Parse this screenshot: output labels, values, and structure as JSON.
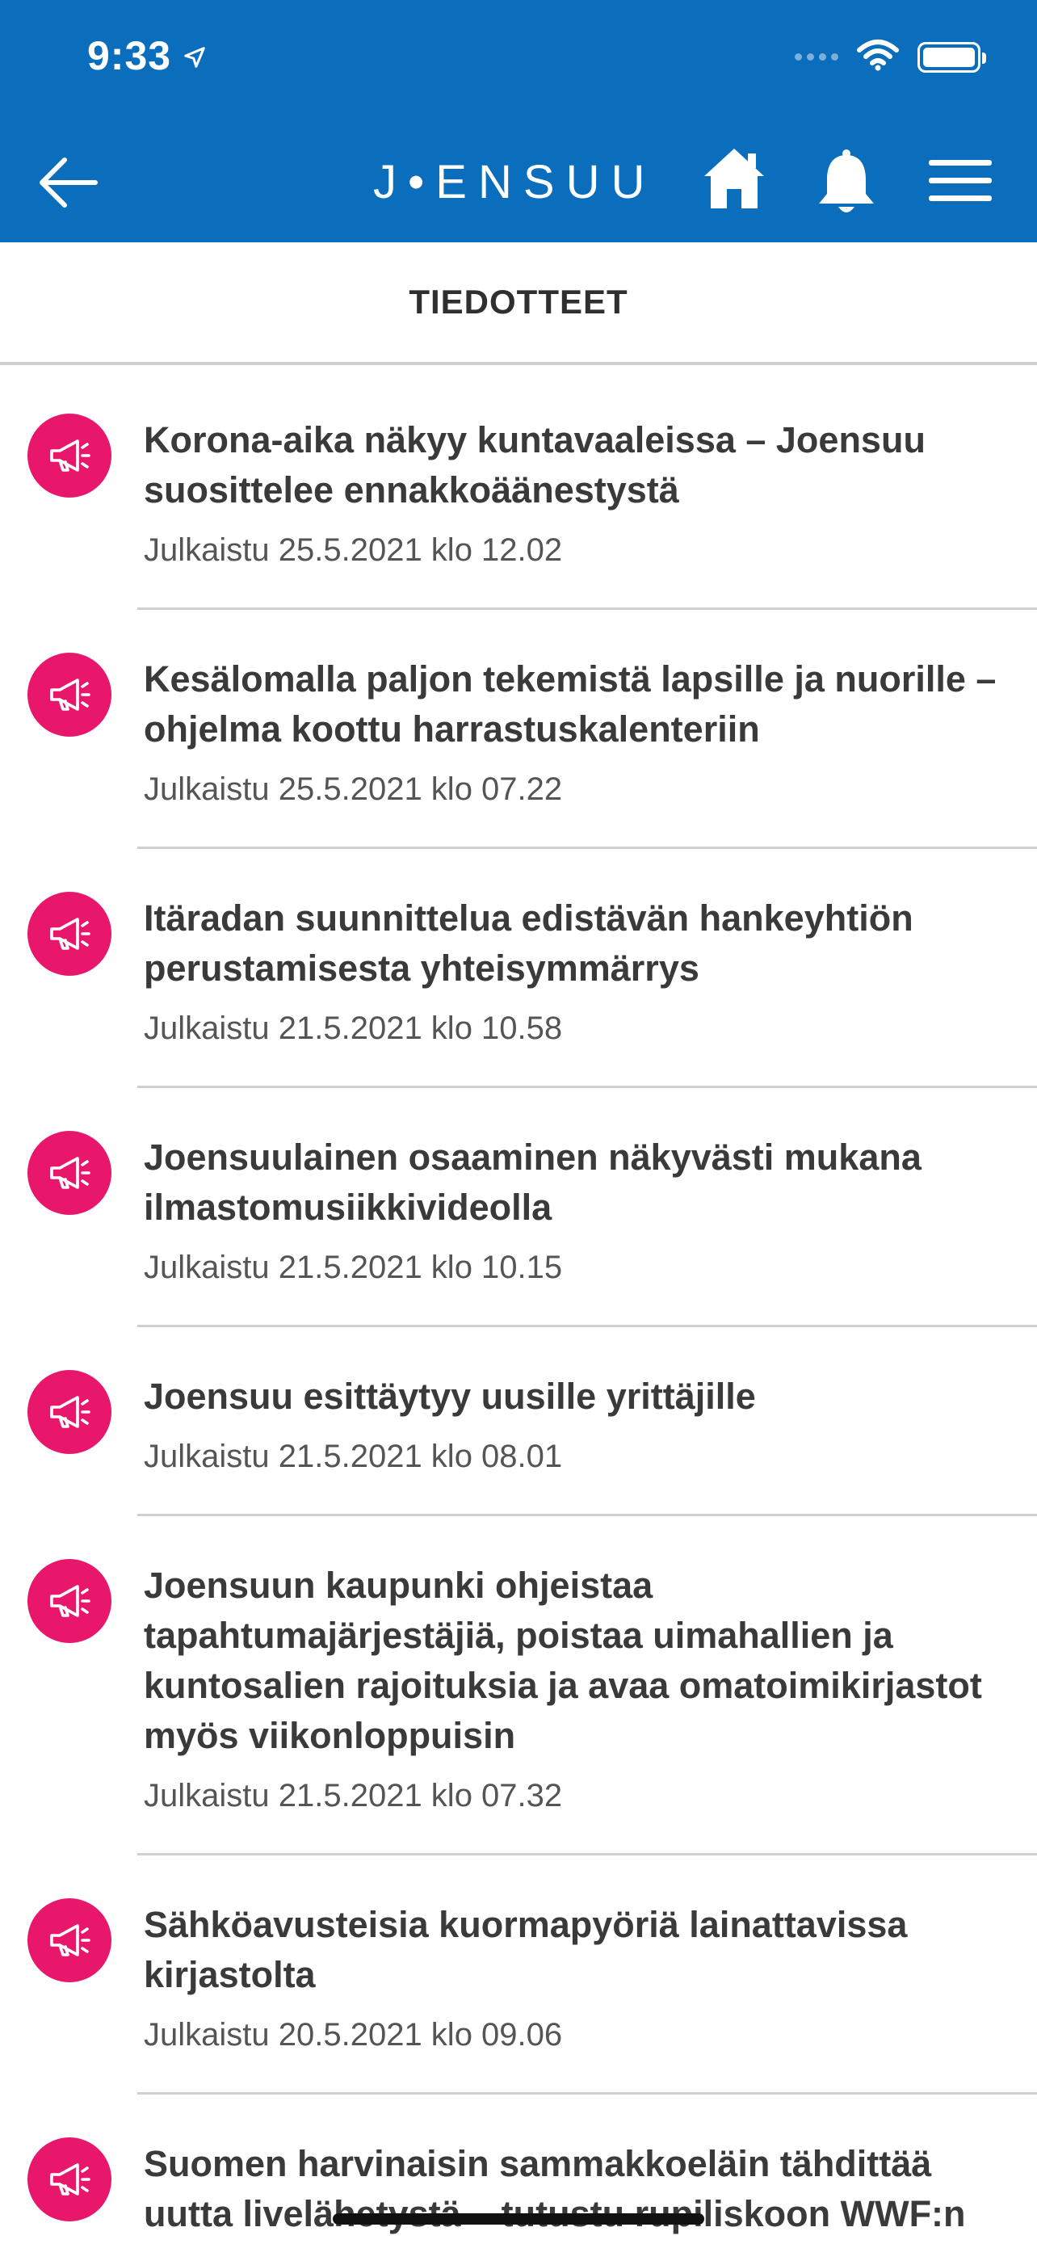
{
  "status_bar": {
    "time": "9:33"
  },
  "header": {
    "logo_text": "J•ENSUU",
    "accent_color": "#0a6ebd"
  },
  "page": {
    "title": "TIEDOTTEET"
  },
  "badge_color": "#e8176c",
  "news": [
    {
      "title": "Korona-aika näkyy kuntavaaleissa – Joensuu suosittelee ennakkoäänestystä",
      "date": "Julkaistu 25.5.2021 klo 12.02"
    },
    {
      "title": "Kesälomalla paljon tekemistä lapsille ja nuorille – ohjelma koottu harrastuskalenteriin",
      "date": "Julkaistu 25.5.2021 klo 07.22"
    },
    {
      "title": "Itäradan suunnittelua edistävän hankeyhtiön perustamisesta yhteisymmärrys",
      "date": "Julkaistu 21.5.2021 klo 10.58"
    },
    {
      "title": "Joensuulainen osaaminen näkyvästi mukana ilmastomusiikkivideolla",
      "date": "Julkaistu 21.5.2021 klo 10.15"
    },
    {
      "title": "Joensuu esittäytyy uusille yrittäjille",
      "date": "Julkaistu 21.5.2021 klo 08.01"
    },
    {
      "title": "Joensuun kaupunki ohjeistaa tapahtumajärjestäjiä, poistaa uimahallien ja kuntosalien rajoituksia ja avaa omatoimikirjastot myös viikonloppuisin",
      "date": "Julkaistu 21.5.2021 klo 07.32"
    },
    {
      "title": "Sähköavusteisia kuormapyöriä lainattavissa kirjastolta",
      "date": "Julkaistu 20.5.2021 klo 09.06"
    },
    {
      "title": "Suomen harvinaisin sammakkoeläin tähdittää uutta livelähetystä – tutustu rupiliskoon WWF:n Luontolivessä",
      "date": ""
    }
  ]
}
